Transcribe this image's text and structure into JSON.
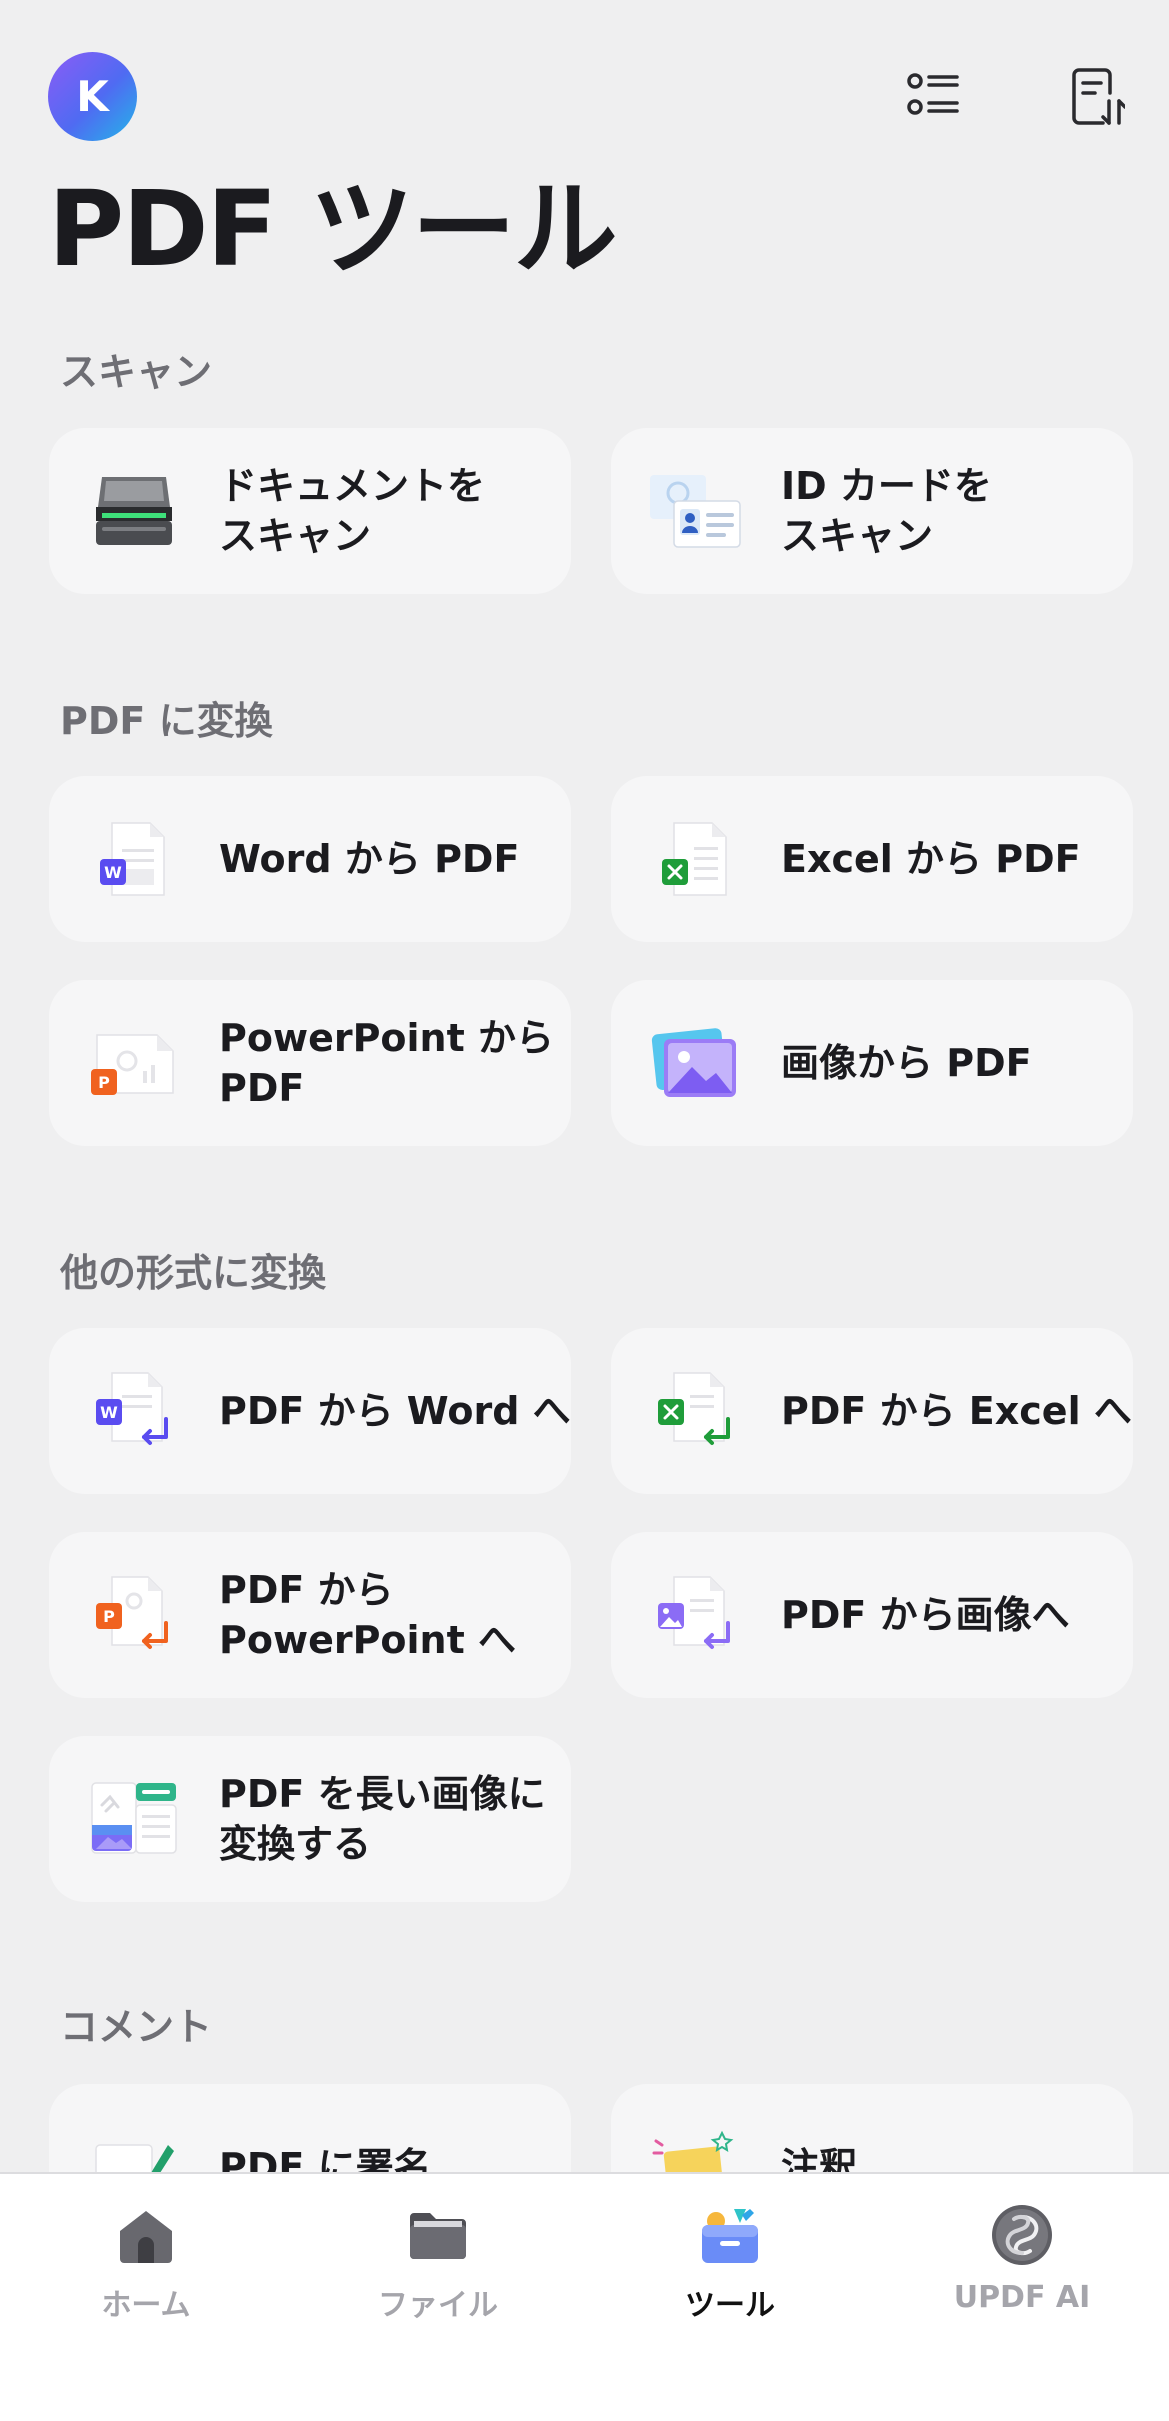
{
  "header": {
    "avatar_letter": "K",
    "title": "PDF ツール"
  },
  "sections": {
    "scan": {
      "title": "スキャン",
      "items": [
        "ドキュメントを\nスキャン",
        "ID カードを\nスキャン"
      ]
    },
    "to_pdf": {
      "title": "PDF に変換",
      "items": [
        "Word から PDF",
        "Excel から PDF",
        "PowerPoint から\nPDF",
        "画像から PDF"
      ]
    },
    "from_pdf": {
      "title": "他の形式に変換",
      "items": [
        "PDF から Word へ",
        "PDF から Excel へ",
        "PDF から\nPowerPoint へ",
        "PDF から画像へ",
        "PDF を長い画像に\n変換する"
      ]
    },
    "comment": {
      "title": "コメント",
      "items": [
        "PDF に署名",
        "注釈"
      ]
    }
  },
  "tab_bar": {
    "tabs": [
      {
        "label": "ホーム",
        "icon": "home-icon"
      },
      {
        "label": "ファイル",
        "icon": "folder-icon"
      },
      {
        "label": "ツール",
        "icon": "toolbox-icon",
        "active": true
      },
      {
        "label": "UPDF AI",
        "icon": "ai-icon"
      }
    ]
  },
  "colors": {
    "word": "#5a4cf0",
    "excel": "#1f9d3a",
    "powerpoint": "#f0621f",
    "image": "#8b6cf5",
    "avatar": "#6b5cf3"
  }
}
